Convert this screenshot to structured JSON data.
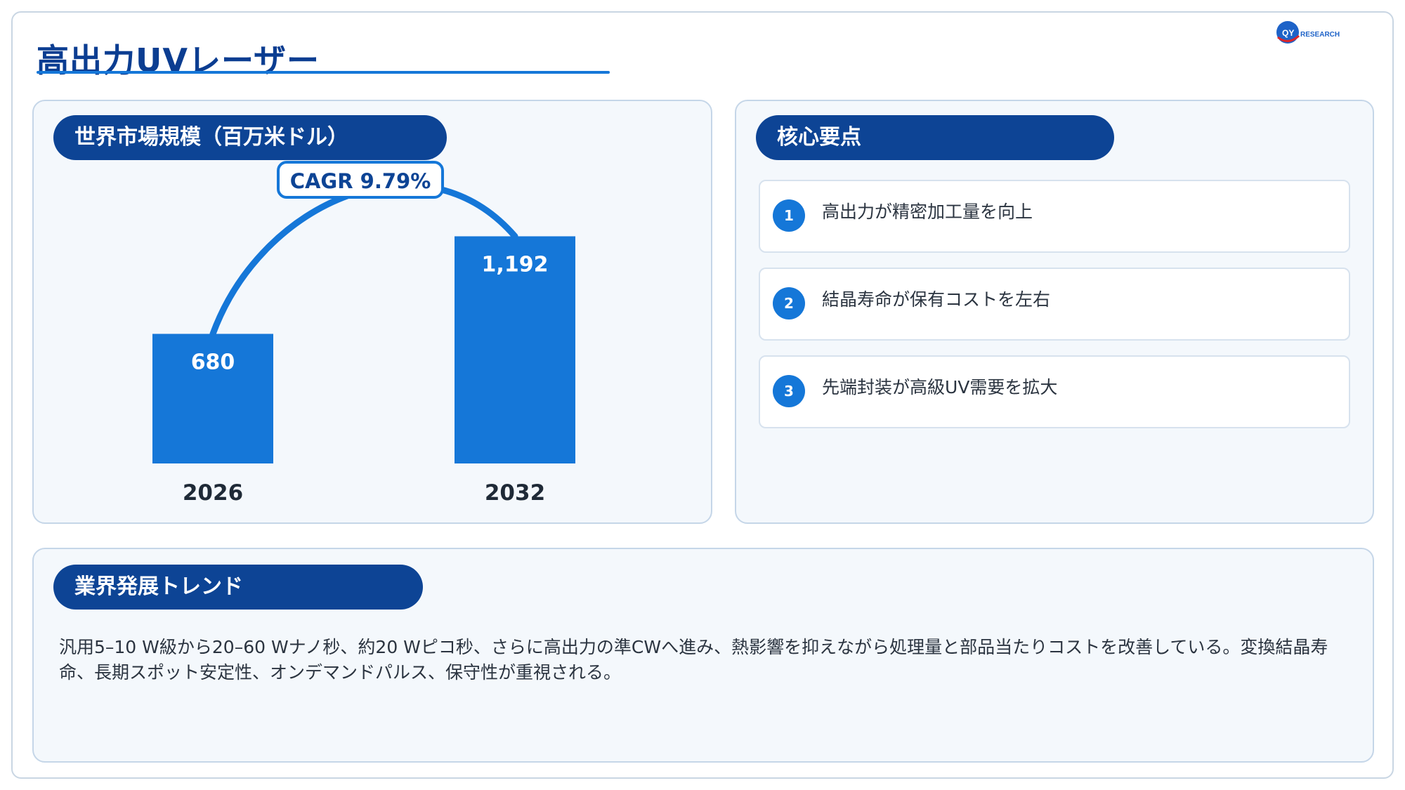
{
  "page": {
    "title": "高出力UVレーザー"
  },
  "logo": {
    "mark": "QY",
    "text": "RESEARCH",
    "colors": {
      "globe": "#1e63c8",
      "accent": "#d9262b"
    }
  },
  "market": {
    "header": "世界市場規模（百万米ドル）",
    "cagr_label": "CAGR 9.79%"
  },
  "chart_data": {
    "type": "bar",
    "title": "世界市場規模（百万米ドル）",
    "categories": [
      "2026",
      "2032"
    ],
    "values": [
      680,
      1192
    ],
    "value_labels": [
      "680",
      "1,192"
    ],
    "annotation": "CAGR 9.79%",
    "bar_color": "#1577d8",
    "arc_color": "#1577d8",
    "grid": false,
    "legend": "none"
  },
  "key_points": {
    "header": "核心要点",
    "items": [
      {
        "num": "1",
        "text": "高出力が精密加工量を向上"
      },
      {
        "num": "2",
        "text": "結晶寿命が保有コストを左右"
      },
      {
        "num": "3",
        "text": "先端封装が高級UV需要を拡大"
      }
    ]
  },
  "trend": {
    "header": "業界発展トレンド",
    "body": "汎用5–10 W級から20–60 Wナノ秒、約20 Wピコ秒、さらに高出力の準CWへ進み、熱影響を抑えながら処理量と部品当たりコストを改善している。変換結晶寿命、長期スポット安定性、オンデマンドパルス、保守性が重視される。"
  },
  "colors": {
    "brand_dark": "#0d4495",
    "accent": "#1577d8",
    "panel_bg": "#f4f8fc"
  }
}
